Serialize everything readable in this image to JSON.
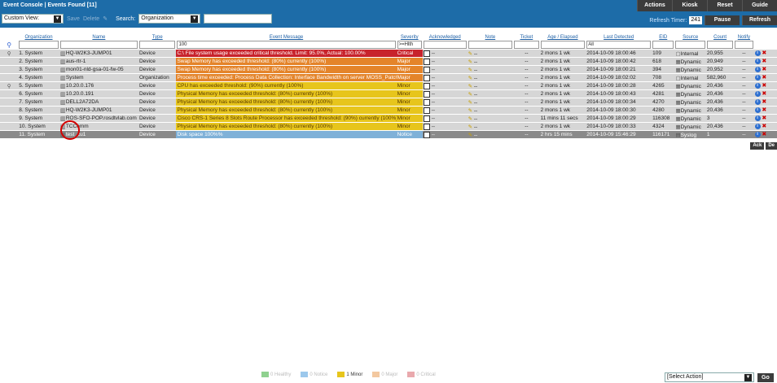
{
  "header": {
    "title": "Event Console | Events Found [11]",
    "custom_view_value": "Custom View:",
    "save_label": "Save",
    "delete_label": "Delete",
    "search_label": "Search:",
    "search_scope": "Organization",
    "search_value": ""
  },
  "toolbar": {
    "actions_label": "Actions",
    "kiosk_label": "Kiosk",
    "reset_label": "Reset",
    "guide_label": "Guide",
    "refresh_timer_label": "Refresh Timer:",
    "refresh_timer_value": "241",
    "pause_label": "Pause",
    "refresh_label": "Refresh"
  },
  "columns": [
    "Organization",
    "Name",
    "Type",
    "Event Message",
    "Severity",
    "Acknowledged",
    "Note",
    "Ticket",
    "Age / Elapsed",
    "Last Detected",
    "EID",
    "Source",
    "Count",
    "Notify"
  ],
  "filters": {
    "message": "100",
    "severity": ">=Hlth",
    "last_detected": "All"
  },
  "events": [
    {
      "num": "1.",
      "org": "System",
      "name": "HQ-W2K3-JUMP01",
      "type": "Device",
      "message": "C:\\ File system usage exceeded critical threshold. Limit: 95.0%, Actual: 100.00%",
      "severity": "Critical",
      "sev": "crit",
      "ack": "--",
      "note": "--",
      "ticket": "--",
      "age": "2 mons 1 wk",
      "last": "2014-10-09 18:00:46",
      "eid": "109",
      "source": "Internal",
      "count": "20,955",
      "notify": "--"
    },
    {
      "num": "2.",
      "org": "System",
      "name": "aus-rtr-1",
      "type": "Device",
      "message": "Swap Memory has exceeded threshold: (80%) currently (100%)",
      "severity": "Major",
      "sev": "major",
      "ack": "--",
      "note": "--",
      "ticket": "--",
      "age": "2 mons 1 wk",
      "last": "2014-10-09 18:00:42",
      "eid": "618",
      "source": "Dynamic",
      "count": "20,949",
      "notify": "--"
    },
    {
      "num": "3.",
      "org": "System",
      "name": "mon01-nld-gsa-01-fw-05",
      "type": "Device",
      "message": "Swap Memory has exceeded threshold: (80%) currently (100%)",
      "severity": "Major",
      "sev": "major",
      "ack": "--",
      "note": "--",
      "ticket": "--",
      "age": "2 mons 1 wk",
      "last": "2014-10-09 18:00:21",
      "eid": "394",
      "source": "Dynamic",
      "count": "20,952",
      "notify": "--"
    },
    {
      "num": "4.",
      "org": "System",
      "name": "System",
      "type": "Organization",
      "message": "Process time exceeded: Process Data Collection: Interface Bandwidth on server MOSS_Patch",
      "severity": "Major",
      "sev": "major",
      "ack": "--",
      "note": "--",
      "ticket": "--",
      "age": "2 mons 1 wk",
      "last": "2014-10-09 18:02:02",
      "eid": "708",
      "source": "Internal",
      "count": "582,960",
      "notify": "--"
    },
    {
      "num": "5.",
      "org": "System",
      "name": "10.20.0.176",
      "type": "Device",
      "message": "CPU has exceeded threshold: (90%) currently (100%)",
      "severity": "Minor",
      "sev": "minor",
      "ack": "--",
      "note": "--",
      "ticket": "--",
      "age": "2 mons 1 wk",
      "last": "2014-10-09 18:00:28",
      "eid": "4265",
      "source": "Dynamic",
      "count": "20,436",
      "notify": "--"
    },
    {
      "num": "6.",
      "org": "System",
      "name": "10.20.0.191",
      "type": "Device",
      "message": "Physical Memory has exceeded threshold: (80%) currently (100%)",
      "severity": "Minor",
      "sev": "minor",
      "ack": "--",
      "note": "--",
      "ticket": "--",
      "age": "2 mons 1 wk",
      "last": "2014-10-09 18:00:43",
      "eid": "4281",
      "source": "Dynamic",
      "count": "20,436",
      "notify": "--"
    },
    {
      "num": "7.",
      "org": "System",
      "name": "DELL2A72DA",
      "type": "Device",
      "message": "Physical Memory has exceeded threshold: (80%) currently (100%)",
      "severity": "Minor",
      "sev": "minor",
      "ack": "--",
      "note": "--",
      "ticket": "--",
      "age": "2 mons 1 wk",
      "last": "2014-10-09 18:00:34",
      "eid": "4270",
      "source": "Dynamic",
      "count": "20,436",
      "notify": "--"
    },
    {
      "num": "8.",
      "org": "System",
      "name": "HQ-W2K3-JUMP01",
      "type": "Device",
      "message": "Physical Memory has exceeded threshold: (80%) currently (100%)",
      "severity": "Minor",
      "sev": "minor",
      "ack": "--",
      "note": "--",
      "ticket": "--",
      "age": "2 mons 1 wk",
      "last": "2014-10-09 18:00:30",
      "eid": "4280",
      "source": "Dynamic",
      "count": "20,436",
      "notify": "--"
    },
    {
      "num": "9.",
      "org": "System",
      "name": "ROS-SFO-POP.rosdtvlab.com",
      "type": "Device",
      "message": "Cisco CRS-1 Series 8 Slots Route Processor has exceeded threshold: (90%) currently (100%)",
      "severity": "Minor",
      "sev": "minor",
      "ack": "--",
      "note": "--",
      "ticket": "--",
      "age": "11 mins 11 secs",
      "last": "2014-10-09 18:00:29",
      "eid": "116308",
      "source": "Dynamic",
      "count": "3",
      "notify": "--"
    },
    {
      "num": "10.",
      "org": "System",
      "name": "TCComm",
      "type": "Device",
      "message": "Physical Memory has exceeded threshold: (80%) currently (100%)",
      "severity": "Minor",
      "sev": "minor",
      "ack": "--",
      "note": "--",
      "ticket": "--",
      "age": "2 mons 1 wk",
      "last": "2014-10-09 18:00:33",
      "eid": "4324",
      "source": "Dynamic",
      "count": "20,436",
      "notify": "--"
    },
    {
      "num": "11.",
      "org": "System",
      "name": "test_cu1",
      "type": "Device",
      "message": "Disk space 100%%",
      "severity": "Notice",
      "sev": "notice",
      "ack": "--",
      "note": "--",
      "ticket": "--",
      "age": "2 hrs 15 mins",
      "last": "2014-10-09 15:46:29",
      "eid": "116171",
      "source": "Syslog",
      "count": "1",
      "notify": "--"
    }
  ],
  "bulk": {
    "ack_label": "Ack",
    "del_label": "De"
  },
  "legend": [
    {
      "label": "0 Healthy",
      "color": "#8fd18f"
    },
    {
      "label": "0 Notice",
      "color": "#9cc8ec"
    },
    {
      "label": "1 Minor",
      "color": "#e7c51c"
    },
    {
      "label": "0 Major",
      "color": "#f3c8a0"
    },
    {
      "label": "0 Critical",
      "color": "#e9a9ad"
    }
  ],
  "footer": {
    "select_action": "[Select Action]",
    "go_label": "Go"
  }
}
